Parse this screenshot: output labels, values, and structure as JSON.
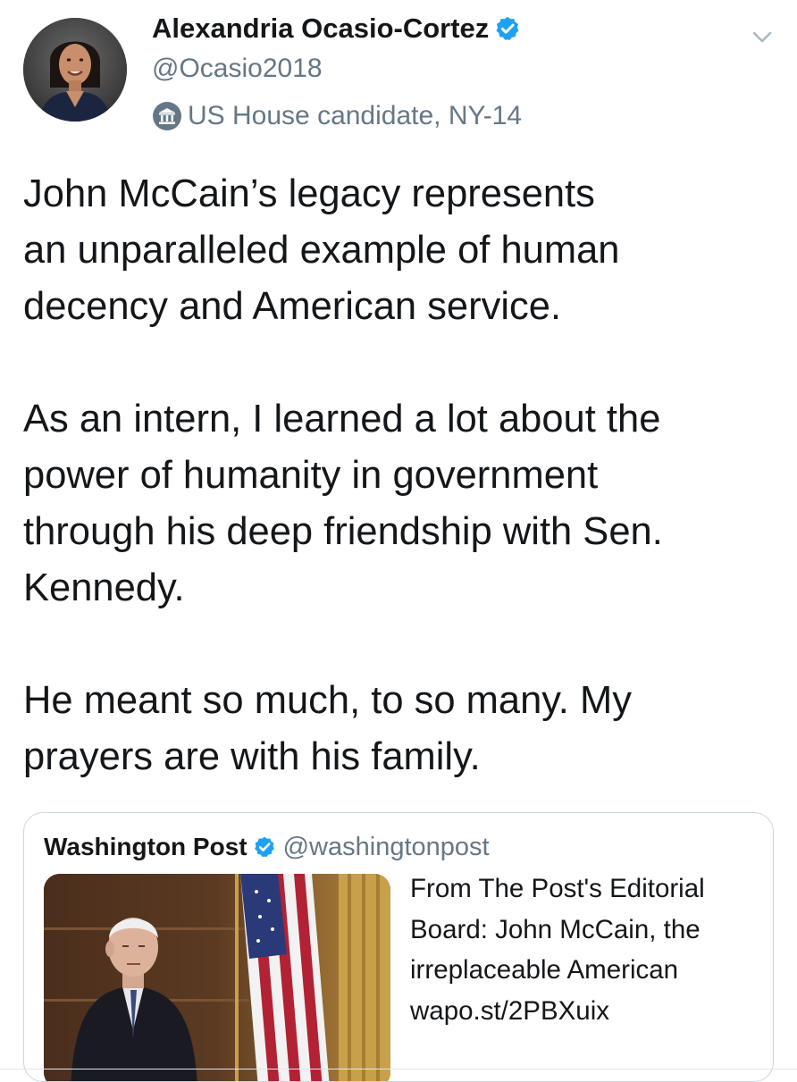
{
  "tweet": {
    "author": {
      "name": "Alexandria Ocasio-Cortez",
      "handle": "@Ocasio2018",
      "label": "US House candidate, NY-14",
      "verified": true
    },
    "paragraphs": [
      "John McCain’s legacy represents\nan unparalleled example of human\ndecency and American service.",
      "As an intern, I learned a lot about the\npower of humanity in government\nthrough his deep friendship with Sen.\nKennedy.",
      "He meant so much, to so many. My\nprayers are with his family."
    ]
  },
  "quote": {
    "name": "Washington Post",
    "handle": "@washingtonpost",
    "verified": true,
    "text_lines": [
      "From The Post's Editorial",
      "Board: John McCain, the",
      "irreplaceable American",
      "wapo.st/2PBXuix"
    ]
  },
  "icons": {
    "verified": "verified-badge-icon",
    "label": "government-building-icon",
    "caret": "chevron-down-icon"
  },
  "colors": {
    "primary_text": "#14171a",
    "secondary_text": "#657786",
    "verified_blue": "#1da1f2",
    "border": "#ccd6dd"
  }
}
